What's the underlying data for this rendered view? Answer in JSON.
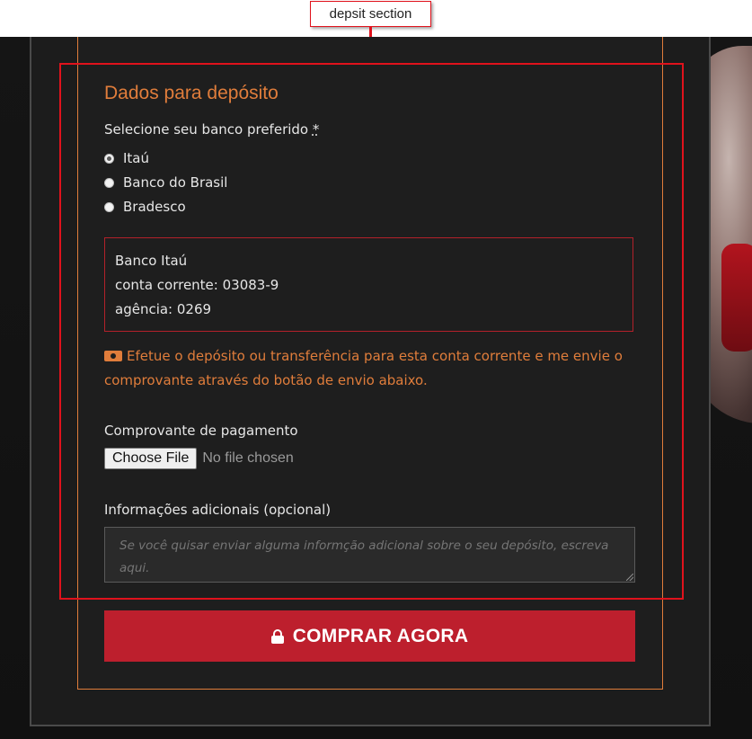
{
  "annotation": {
    "label": "depsit section"
  },
  "deposit_section": {
    "title": "Dados para depósito",
    "bank_select": {
      "label": "Selecione seu banco preferido",
      "required_marker": "*",
      "options": [
        "Itaú",
        "Banco do Brasil",
        "Bradesco"
      ],
      "selected": "Itaú"
    },
    "bank_info": {
      "bank_name": "Banco Itaú",
      "account": "conta corrente: 03083-9",
      "agency": "agência: 0269"
    },
    "notice": {
      "icon": "money-icon",
      "text": "Efetue o depósito ou transferência para esta conta corrente e me envie o comprovante através do botão de envio abaixo."
    },
    "payment_proof": {
      "label": "Comprovante de pagamento",
      "button_label": "Choose File",
      "status": "No file chosen"
    },
    "additional_info": {
      "label": "Informações adicionais (opcional)",
      "placeholder": "Se você quisar enviar alguma informção adicional sobre o seu depósito, escreva aqui."
    }
  },
  "buy_button": {
    "icon": "lock-icon",
    "label": "COMPRAR AGORA"
  },
  "colors": {
    "accent_orange": "#e07d3b",
    "button_red": "#bd1f2d",
    "highlight_red": "#e0121c",
    "background": "#1e1e1e"
  }
}
